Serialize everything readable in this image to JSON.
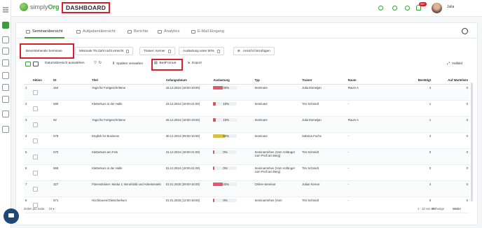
{
  "app": {
    "logo_text_part1": "simply",
    "logo_text_part2": "Org",
    "page_title": "DASHBOARD",
    "user_name": "Julia",
    "notifications": "99+"
  },
  "tabs": [
    {
      "label": "Seminarübersicht",
      "icon": "list-icon",
      "active": true
    },
    {
      "label": "Aufgabenübersicht",
      "icon": "tasks-icon"
    },
    {
      "label": "Berichte",
      "icon": "report-icon"
    },
    {
      "label": "Analytics",
      "icon": "analytics-icon"
    },
    {
      "label": "E-Mail Eingang",
      "icon": "mail-icon"
    }
  ],
  "views": [
    {
      "label": "Bevorstehende Seminare"
    },
    {
      "label": "Minimale TN Zahl nicht erreicht"
    },
    {
      "label": "Trainer: Kerner"
    },
    {
      "label": "Auslastung unter 50%"
    },
    {
      "label": "Ansicht hinzufügen"
    }
  ],
  "toolbar": {
    "date_range": "Datumsbereich auswählen",
    "columns": "Spalten verwalten",
    "bedformat": "BedFormat",
    "export": "Export",
    "fullscreen": "Vollbild"
  },
  "table": {
    "headers": [
      "Aktion",
      "ID",
      "Titel",
      "Anfangsdatum",
      "Auslastung",
      "Typ",
      "Trainer",
      "Raum",
      "Bestätigt",
      "Auf Warteliste"
    ],
    "rows": [
      {
        "n": "1",
        "id": "164",
        "title": "Yoga für Fortgeschrittene",
        "date": "18.12.2024 (18:00-19:00)",
        "util": "40%",
        "util_value": 40,
        "util_color": "#e05a6a",
        "type": "Seminare",
        "trainer": "Julia Esmeijan",
        "room": "Raum A",
        "conf": "4",
        "wait": "0"
      },
      {
        "n": "2",
        "id": "580",
        "title": "Kletterkurs in der Halle",
        "date": "23.12.2024 (18:00-21:00)",
        "util": "10%",
        "util_value": 10,
        "util_color": "#c95b5b",
        "type": "Seminare",
        "trainer": "Tim Schmidt",
        "room": "-",
        "conf": "1",
        "wait": "0"
      },
      {
        "n": "3",
        "id": "92",
        "title": "Yoga für Fortgeschrittene",
        "date": "25.12.2024 (18:00-19:00)",
        "util": "10%",
        "util_value": 10,
        "util_color": "#c95b5b",
        "type": "Seminare",
        "trainer": "Julia Esmeijan",
        "room": "Raum A",
        "conf": "1",
        "wait": "0"
      },
      {
        "n": "4",
        "id": "579",
        "title": "English for Business",
        "date": "30.12.2024 (09:00-16:00)",
        "util": "50%",
        "util_value": 50,
        "util_color": "#d8c04a",
        "type": "Seminare",
        "trainer": "Sabrina Fuchs",
        "room": "-",
        "conf": "4",
        "wait": "0"
      },
      {
        "n": "5",
        "id": "570",
        "title": "Kletterkurs am Fels",
        "date": "31.12.2024 (18:00-21:00)",
        "util": "0%",
        "util_value": 0,
        "util_color": "#c95b5b",
        "type": "Seminarreihen (Vom Anfänger zum Profi am Berg)",
        "trainer": "Tim Schmidt",
        "room": "-",
        "conf": "0",
        "wait": "0"
      },
      {
        "n": "6",
        "id": "569",
        "title": "Kletterkurs in der Halle",
        "date": "31.12.2024 (18:00-21:00)",
        "util": "0%",
        "util_value": 0,
        "util_color": "#c95b5b",
        "type": "Seminarreihen (Vom Anfänger zum Profi am Berg)",
        "trainer": "Tim Schmidt",
        "room": "-",
        "conf": "0",
        "wait": "0"
      },
      {
        "n": "7",
        "id": "327",
        "title": "Fitnesstrainer: Modul 1: Berufsbild und Arbeitsmarkt",
        "date": "01.01.2025 (09:00-16:00)",
        "util": "40%",
        "util_value": 40,
        "util_color": "#e05a6a",
        "type": "Online-Seminar",
        "trainer": "Julian Kerner",
        "room": "-",
        "conf": "4",
        "wait": "0"
      },
      {
        "n": "8",
        "id": "571",
        "title": "Hochtouren/Gletscherkurs",
        "date": "01.01.2025 (12:00-18:00)",
        "util": "0%",
        "util_value": 0,
        "util_color": "#c95b5b",
        "type": "Seminarreihen (Vom",
        "trainer": "Tim Schmidt",
        "room": "-",
        "conf": "0",
        "wait": "0"
      }
    ]
  },
  "footer": {
    "rows_per_page_label": "Zeilen pro Seite:",
    "rows_per_page": "10",
    "range": "1 - 10 von 85",
    "prev": "Vorherige",
    "next": "Weiter"
  }
}
